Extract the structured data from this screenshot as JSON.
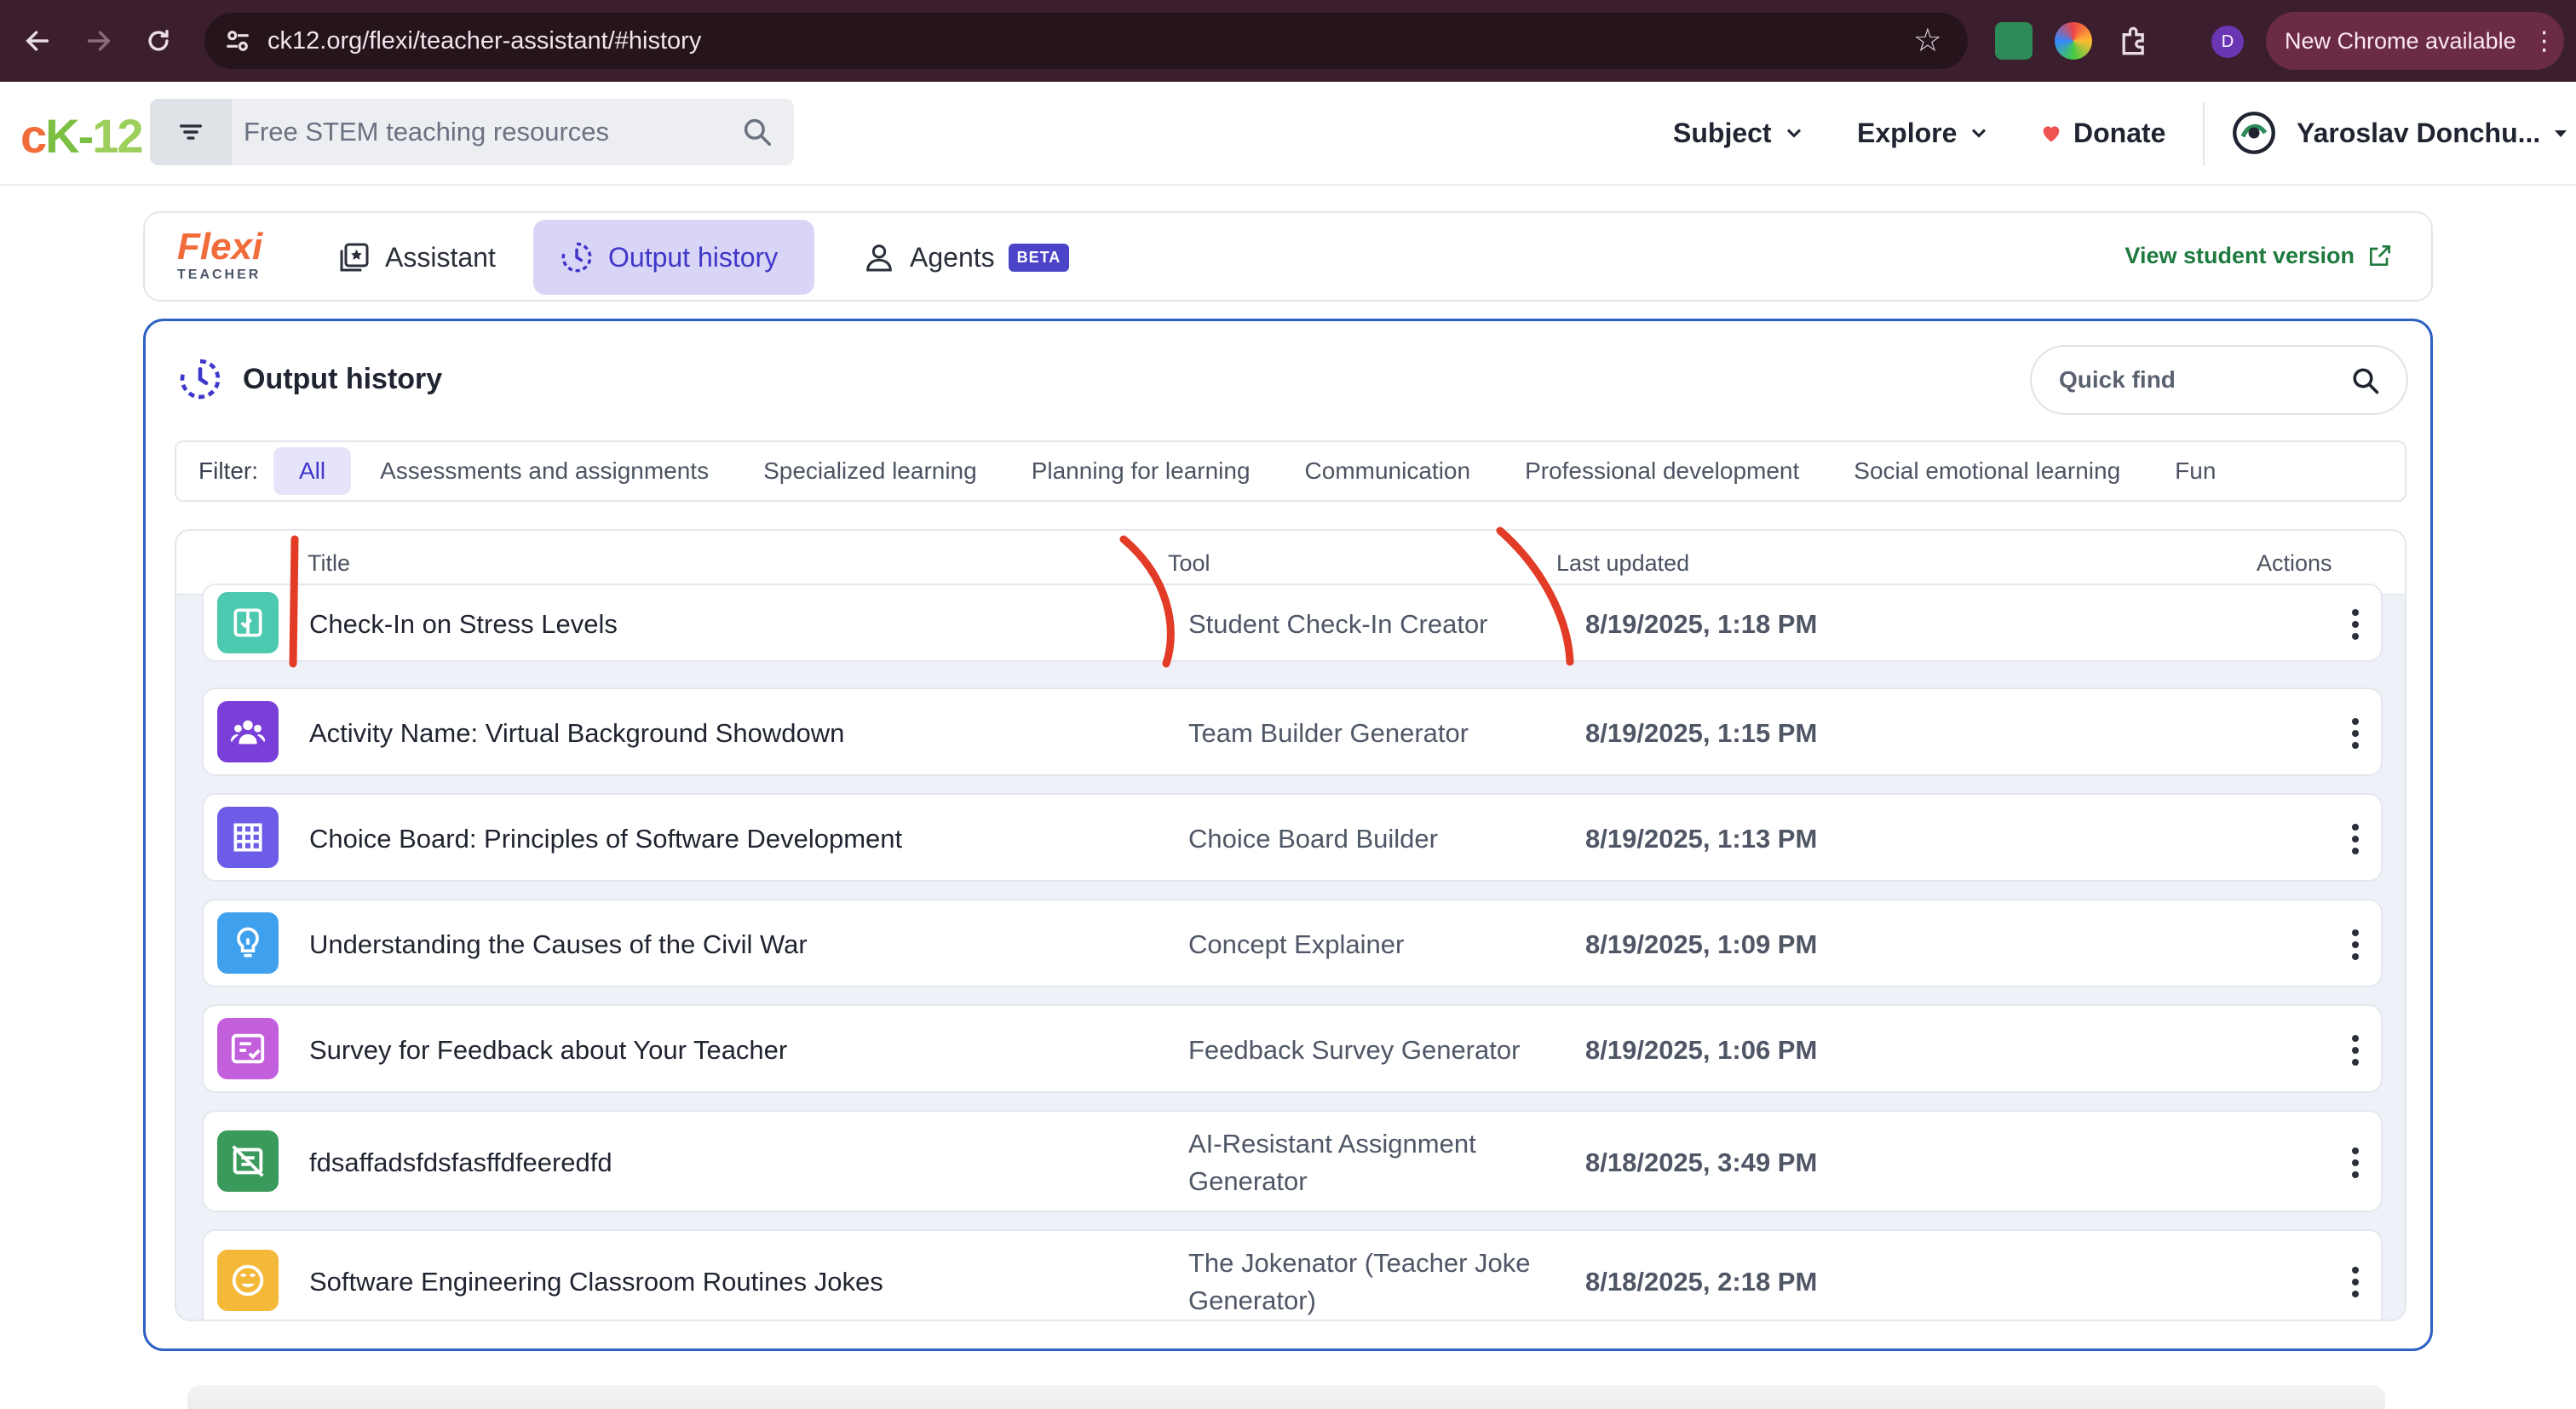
{
  "browser": {
    "url": "ck12.org/flexi/teacher-assistant/#history",
    "profile_initial": "D",
    "new_chrome_label": "New Chrome available"
  },
  "header": {
    "logo": {
      "c": "c",
      "k": "K",
      "dash": "-",
      "num": "12"
    },
    "search_placeholder": "Free STEM teaching resources",
    "nav": [
      {
        "label": "Subject"
      },
      {
        "label": "Explore"
      },
      {
        "label": "Donate"
      }
    ],
    "user_name": "Yaroslav Donchu..."
  },
  "tabs_bar": {
    "flexi_word": "Flexi",
    "flexi_sub": "TEACHER",
    "tabs": [
      {
        "label": "Assistant",
        "active": false
      },
      {
        "label": "Output history",
        "active": true
      },
      {
        "label": "Agents",
        "badge": "BETA",
        "active": false
      }
    ],
    "view_student": "View student version"
  },
  "panel": {
    "title": "Output history",
    "quick_find_placeholder": "Quick find",
    "filter_label": "Filter:",
    "filters": [
      {
        "label": "All",
        "active": true
      },
      {
        "label": "Assessments and assignments"
      },
      {
        "label": "Specialized learning"
      },
      {
        "label": "Planning for learning"
      },
      {
        "label": "Communication"
      },
      {
        "label": "Professional development"
      },
      {
        "label": "Social emotional learning"
      },
      {
        "label": "Fun"
      }
    ],
    "columns": {
      "title": "Title",
      "tool": "Tool",
      "updated": "Last updated",
      "actions": "Actions"
    },
    "rows": [
      {
        "title": "Check-In on Stress Levels",
        "tool": "Student Check-In Creator",
        "updated": "8/19/2025, 1:18 PM",
        "icon": "checkin-icon",
        "color": "#4dc9b0"
      },
      {
        "title": "Activity Name: Virtual Background Showdown",
        "tool": "Team Builder Generator",
        "updated": "8/19/2025, 1:15 PM",
        "icon": "team-icon",
        "color": "#7b3fd9"
      },
      {
        "title": "Choice Board: Principles of Software Development",
        "tool": "Choice Board Builder",
        "updated": "8/19/2025, 1:13 PM",
        "icon": "grid-icon",
        "color": "#6c5ce7"
      },
      {
        "title": "Understanding the Causes of the Civil War",
        "tool": "Concept Explainer",
        "updated": "8/19/2025, 1:09 PM",
        "icon": "lightbulb-icon",
        "color": "#3fa0ee"
      },
      {
        "title": "Survey for Feedback about Your Teacher",
        "tool": "Feedback Survey Generator",
        "updated": "8/19/2025, 1:06 PM",
        "icon": "survey-icon",
        "color": "#c35fdc"
      },
      {
        "title": "fdsaffadsfdsfasffdfeeredfd",
        "tool": "AI-Resistant Assignment Generator",
        "updated": "8/18/2025, 3:49 PM",
        "icon": "no-ai-icon",
        "color": "#3a9a5c"
      },
      {
        "title": "Software Engineering Classroom Routines Jokes",
        "tool": "The Jokenator (Teacher Joke Generator)",
        "updated": "8/18/2025, 2:18 PM",
        "icon": "smile-icon",
        "color": "#f5b93a"
      }
    ]
  }
}
